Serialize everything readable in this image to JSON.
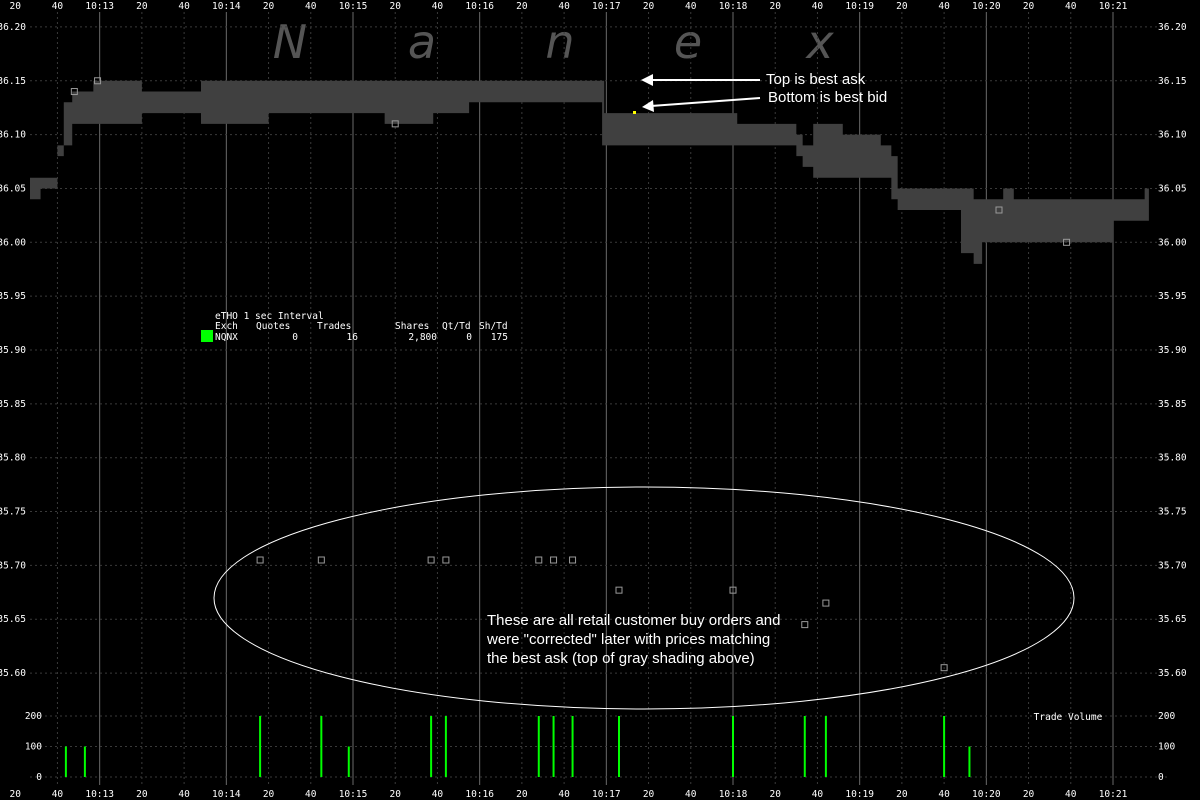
{
  "chart_data": {
    "type": "area",
    "watermark_letters": [
      "N",
      "a",
      "n",
      "e",
      "x"
    ],
    "x_axis": {
      "start": "10:12:27",
      "end": "10:21:27",
      "ticks": [
        {
          "t": "10:12:20",
          "label": "20"
        },
        {
          "t": "10:12:40",
          "label": "40"
        },
        {
          "t": "10:13:00",
          "label": "10:13"
        },
        {
          "t": "10:13:20",
          "label": "20"
        },
        {
          "t": "10:13:40",
          "label": "40"
        },
        {
          "t": "10:14:00",
          "label": "10:14"
        },
        {
          "t": "10:14:20",
          "label": "20"
        },
        {
          "t": "10:14:40",
          "label": "40"
        },
        {
          "t": "10:15:00",
          "label": "10:15"
        },
        {
          "t": "10:15:20",
          "label": "20"
        },
        {
          "t": "10:15:40",
          "label": "40"
        },
        {
          "t": "10:16:00",
          "label": "10:16"
        },
        {
          "t": "10:16:20",
          "label": "20"
        },
        {
          "t": "10:16:40",
          "label": "40"
        },
        {
          "t": "10:17:00",
          "label": "10:17"
        },
        {
          "t": "10:17:20",
          "label": "20"
        },
        {
          "t": "10:17:40",
          "label": "40"
        },
        {
          "t": "10:18:00",
          "label": "10:18"
        },
        {
          "t": "10:18:20",
          "label": "20"
        },
        {
          "t": "10:18:40",
          "label": "40"
        },
        {
          "t": "10:19:00",
          "label": "10:19"
        },
        {
          "t": "10:19:20",
          "label": "20"
        },
        {
          "t": "10:19:40",
          "label": "40"
        },
        {
          "t": "10:20:00",
          "label": "10:20"
        },
        {
          "t": "10:20:20",
          "label": "20"
        },
        {
          "t": "10:20:40",
          "label": "40"
        },
        {
          "t": "10:21:00",
          "label": "10:21"
        }
      ]
    },
    "price_axis": {
      "ylim": [
        35.575,
        36.225
      ],
      "ticks": [
        "36.20",
        "36.15",
        "36.10",
        "36.05",
        "36.00",
        "35.95",
        "35.90",
        "35.85",
        "35.80",
        "35.75",
        "35.70",
        "35.65",
        "35.60"
      ]
    },
    "volume_axis": {
      "ylim": [
        0,
        200
      ],
      "ticks": [
        "200",
        "100",
        "0"
      ],
      "title": "Trade Volume"
    },
    "grid": true,
    "nbbo_spread": [
      {
        "t": "10:12:27",
        "ask": 36.06,
        "bid": 36.03
      },
      {
        "t": "10:12:32",
        "ask": 36.06,
        "bid": 36.04
      },
      {
        "t": "10:12:40",
        "ask": 36.08,
        "bid": 36.05
      },
      {
        "t": "10:12:43",
        "ask": 36.13,
        "bid": 36.09
      },
      {
        "t": "10:12:47",
        "ask": 36.14,
        "bid": 36.09
      },
      {
        "t": "10:12:54",
        "ask": 36.14,
        "bid": 36.11
      },
      {
        "t": "10:12:57",
        "ask": 36.15,
        "bid": 36.11
      },
      {
        "t": "10:13:20",
        "ask": 36.14,
        "bid": 36.11
      },
      {
        "t": "10:13:40",
        "ask": 36.14,
        "bid": 36.12
      },
      {
        "t": "10:13:48",
        "ask": 36.15,
        "bid": 36.12
      },
      {
        "t": "10:14:20",
        "ask": 36.15,
        "bid": 36.11
      },
      {
        "t": "10:15:15",
        "ask": 36.15,
        "bid": 36.12
      },
      {
        "t": "10:15:38",
        "ask": 36.15,
        "bid": 36.11
      },
      {
        "t": "10:15:55",
        "ask": 36.15,
        "bid": 36.12
      },
      {
        "t": "10:16:25",
        "ask": 36.15,
        "bid": 36.13
      },
      {
        "t": "10:16:58",
        "ask": 36.15,
        "bid": 36.13
      },
      {
        "t": "10:16:59",
        "ask": 36.12,
        "bid": 36.09
      },
      {
        "t": "10:17:12",
        "ask": 36.12,
        "bid": 36.09
      },
      {
        "t": "10:17:55",
        "ask": 36.12,
        "bid": 36.09
      },
      {
        "t": "10:18:02",
        "ask": 36.11,
        "bid": 36.09
      },
      {
        "t": "10:18:30",
        "ask": 36.1,
        "bid": 36.09
      },
      {
        "t": "10:18:33",
        "ask": 36.09,
        "bid": 36.08
      },
      {
        "t": "10:18:38",
        "ask": 36.11,
        "bid": 36.07
      },
      {
        "t": "10:18:52",
        "ask": 36.1,
        "bid": 36.06
      },
      {
        "t": "10:19:10",
        "ask": 36.09,
        "bid": 36.06
      },
      {
        "t": "10:19:15",
        "ask": 36.08,
        "bid": 36.06
      },
      {
        "t": "10:19:18",
        "ask": 36.05,
        "bid": 36.04
      },
      {
        "t": "10:19:25",
        "ask": 36.05,
        "bid": 36.03
      },
      {
        "t": "10:19:48",
        "ask": 36.05,
        "bid": 36.03
      },
      {
        "t": "10:19:54",
        "ask": 36.04,
        "bid": 35.99
      },
      {
        "t": "10:19:58",
        "ask": 36.04,
        "bid": 35.98
      },
      {
        "t": "10:20:02",
        "ask": 36.04,
        "bid": 36.0
      },
      {
        "t": "10:20:08",
        "ask": 36.05,
        "bid": 36.0
      },
      {
        "t": "10:20:13",
        "ask": 36.04,
        "bid": 36.0
      },
      {
        "t": "10:20:25",
        "ask": 36.04,
        "bid": 36.0
      },
      {
        "t": "10:20:35",
        "ask": 36.04,
        "bid": 36.0
      },
      {
        "t": "10:21:00",
        "ask": 36.04,
        "bid": 36.0
      },
      {
        "t": "10:21:15",
        "ask": 36.05,
        "bid": 36.02
      },
      {
        "t": "10:21:17",
        "ask": 36.05,
        "bid": 36.02
      }
    ],
    "trades": [
      {
        "t": "10:12:48",
        "price": 36.14
      },
      {
        "t": "10:12:59",
        "price": 36.15
      },
      {
        "t": "10:15:20",
        "price": 36.11
      },
      {
        "t": "10:20:06",
        "price": 36.03
      },
      {
        "t": "10:20:38",
        "price": 36.0
      },
      {
        "t": "10:14:16",
        "price": 35.705
      },
      {
        "t": "10:14:45",
        "price": 35.705
      },
      {
        "t": "10:15:37",
        "price": 35.705
      },
      {
        "t": "10:15:44",
        "price": 35.705
      },
      {
        "t": "10:16:28",
        "price": 35.705
      },
      {
        "t": "10:16:35",
        "price": 35.705
      },
      {
        "t": "10:16:44",
        "price": 35.705
      },
      {
        "t": "10:17:06",
        "price": 35.677
      },
      {
        "t": "10:18:00",
        "price": 35.677
      },
      {
        "t": "10:18:34",
        "price": 35.645
      },
      {
        "t": "10:18:44",
        "price": 35.665
      },
      {
        "t": "10:19:40",
        "price": 35.605
      }
    ],
    "volume_bars": [
      {
        "t": "10:12:44",
        "value": 100
      },
      {
        "t": "10:12:53",
        "value": 100
      },
      {
        "t": "10:14:16",
        "value": 200
      },
      {
        "t": "10:14:45",
        "value": 200
      },
      {
        "t": "10:14:58",
        "value": 100
      },
      {
        "t": "10:15:37",
        "value": 200
      },
      {
        "t": "10:15:44",
        "value": 200
      },
      {
        "t": "10:16:28",
        "value": 200
      },
      {
        "t": "10:16:35",
        "value": 200
      },
      {
        "t": "10:16:44",
        "value": 200
      },
      {
        "t": "10:17:06",
        "value": 200
      },
      {
        "t": "10:18:00",
        "value": 200
      },
      {
        "t": "10:18:34",
        "value": 200
      },
      {
        "t": "10:18:44",
        "value": 200
      },
      {
        "t": "10:19:40",
        "value": 200
      },
      {
        "t": "10:19:52",
        "value": 100
      }
    ],
    "legend": {
      "title": "eTHO 1 sec Interval",
      "headers": [
        "Exch",
        "Quotes",
        "Trades",
        "Shares",
        "Qt/Td",
        "Sh/Td"
      ],
      "row": {
        "exch": "NQNX",
        "quotes": "0",
        "trades": "16",
        "shares": "2,800",
        "qt_td": "0",
        "sh_td": "175",
        "color": "#00ff00"
      }
    },
    "annotations": {
      "top_label": "Top is best ask",
      "bottom_label": "Bottom is best bid",
      "ellipse_text": [
        "These are all retail customer buy orders and",
        "were \"corrected\" later with prices matching",
        "the best ask (top of gray shading above)"
      ]
    },
    "colors": {
      "background": "#000000",
      "spread": "#404040",
      "grid": "#3a3a3a",
      "volume": "#00ff00",
      "text": "#ffffff"
    }
  }
}
